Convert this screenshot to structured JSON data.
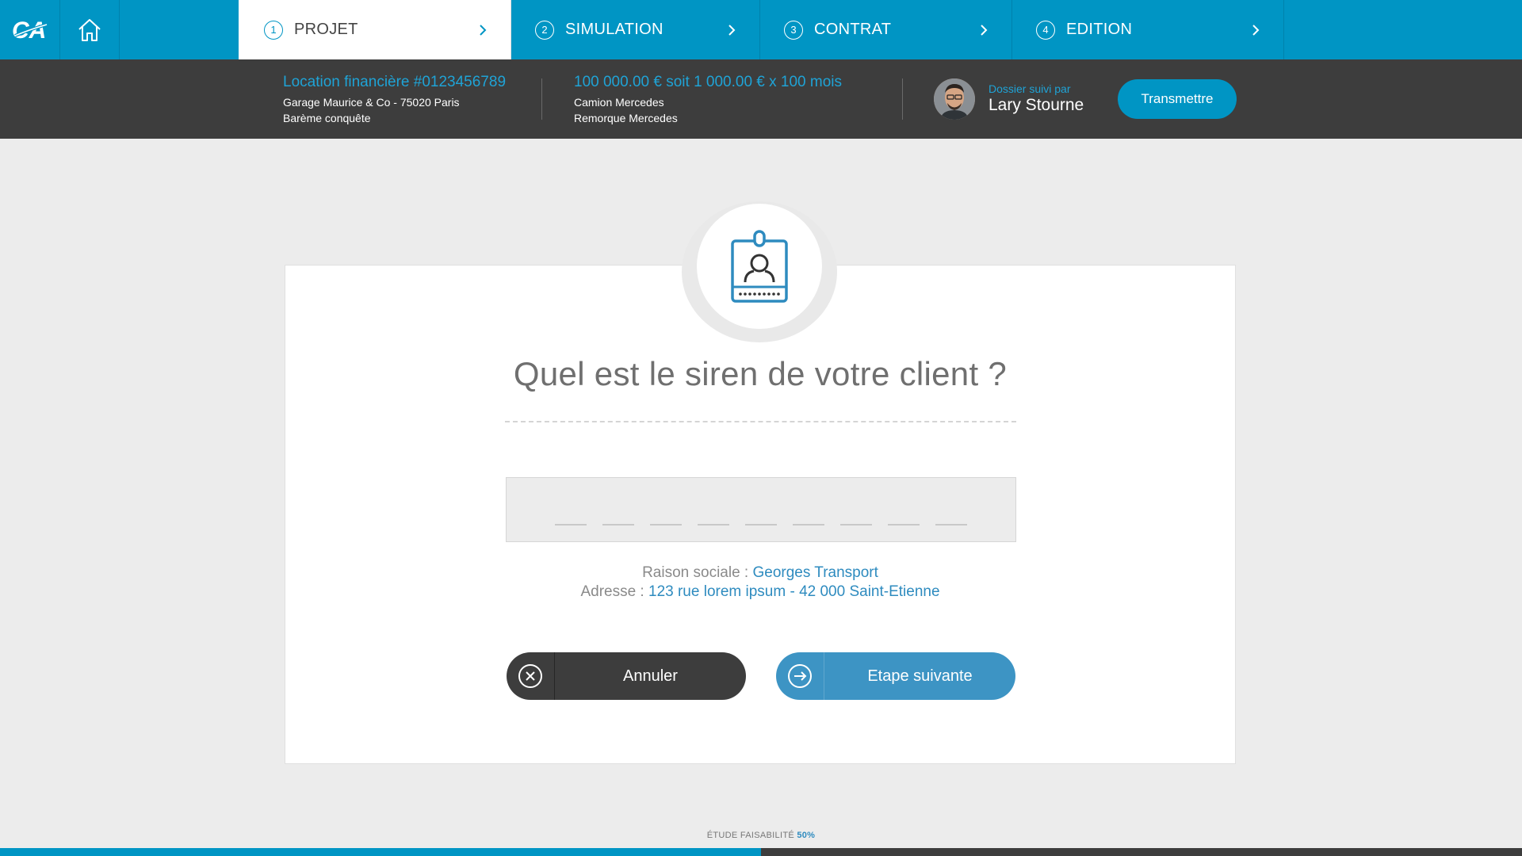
{
  "nav": {
    "logo": "CA",
    "steps": [
      {
        "num": "1",
        "label": "PROJET",
        "active": true
      },
      {
        "num": "2",
        "label": "SIMULATION",
        "active": false
      },
      {
        "num": "3",
        "label": "CONTRAT",
        "active": false
      },
      {
        "num": "4",
        "label": "EDITION",
        "active": false
      }
    ]
  },
  "project": {
    "title": "Location financière #0123456789",
    "client": "Garage Maurice & Co - 75020 Paris",
    "bareme": "Barème conquête",
    "amount": "100 000.00 € soit 1 000.00 € x 100 mois",
    "item1": "Camion Mercedes",
    "item2": "Remorque Mercedes",
    "followed_by_label": "Dossier suivi par",
    "followed_by_name": "Lary Stourne",
    "transmit_label": "Transmettre"
  },
  "form": {
    "question": "Quel est le siren de votre client ?",
    "siren_value": "",
    "siren_digits": 9,
    "raison_label": "Raison sociale : ",
    "raison_value": "Georges Transport",
    "adresse_label": "Adresse : ",
    "adresse_value": "123 rue lorem ipsum - 42 000 Saint-Etienne",
    "cancel_label": "Annuler",
    "next_label": "Etape suivante"
  },
  "footer": {
    "feasibility_label": "ÉTUDE FAISABILITÉ",
    "feasibility_pct": "50%",
    "progress": 0.5
  },
  "colors": {
    "brand_blue": "#0095c4",
    "dark": "#3d3d3d",
    "link_blue": "#2e8bbf"
  }
}
